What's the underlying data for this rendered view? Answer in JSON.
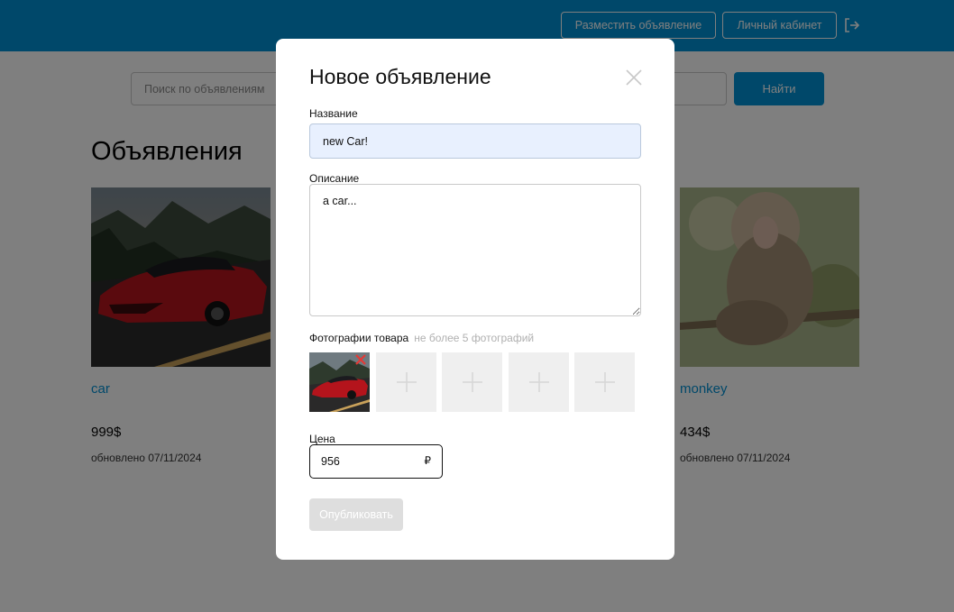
{
  "header": {
    "post_ad_label": "Разместить объявление",
    "cabinet_label": "Личный кабинет",
    "background_color": "#0091d4",
    "logout_icon": "logout-icon"
  },
  "search": {
    "placeholder": "Поиск по объявлениям",
    "button_label": "Найти"
  },
  "page": {
    "title": "Объявления"
  },
  "listings": [
    {
      "title": "car",
      "price": "999$",
      "updated": "обновлено 07/11/2024",
      "image": "red sports car on road"
    },
    {
      "title": "monkey",
      "price": "434$",
      "updated": "обновлено 07/11/2024",
      "image": "monkey sitting on branch"
    }
  ],
  "modal": {
    "title": "Новое объявление",
    "close_icon": "close-icon",
    "name": {
      "label": "Название",
      "value": "new Car!"
    },
    "description": {
      "label": "Описание",
      "value": "a car..."
    },
    "photos": {
      "label": "Фотографии товара",
      "hint": "не более 5 фотографий",
      "uploaded": [
        "red sports car"
      ],
      "empty_slots": 4
    },
    "price": {
      "label": "Цена",
      "value": "956",
      "currency": "₽"
    },
    "publish_label": "Опубликовать"
  },
  "colors": {
    "accent": "#0091d4",
    "remove": "#e53935",
    "disabled_button": "#dedede",
    "autofill_field": "#e8f0fe"
  }
}
